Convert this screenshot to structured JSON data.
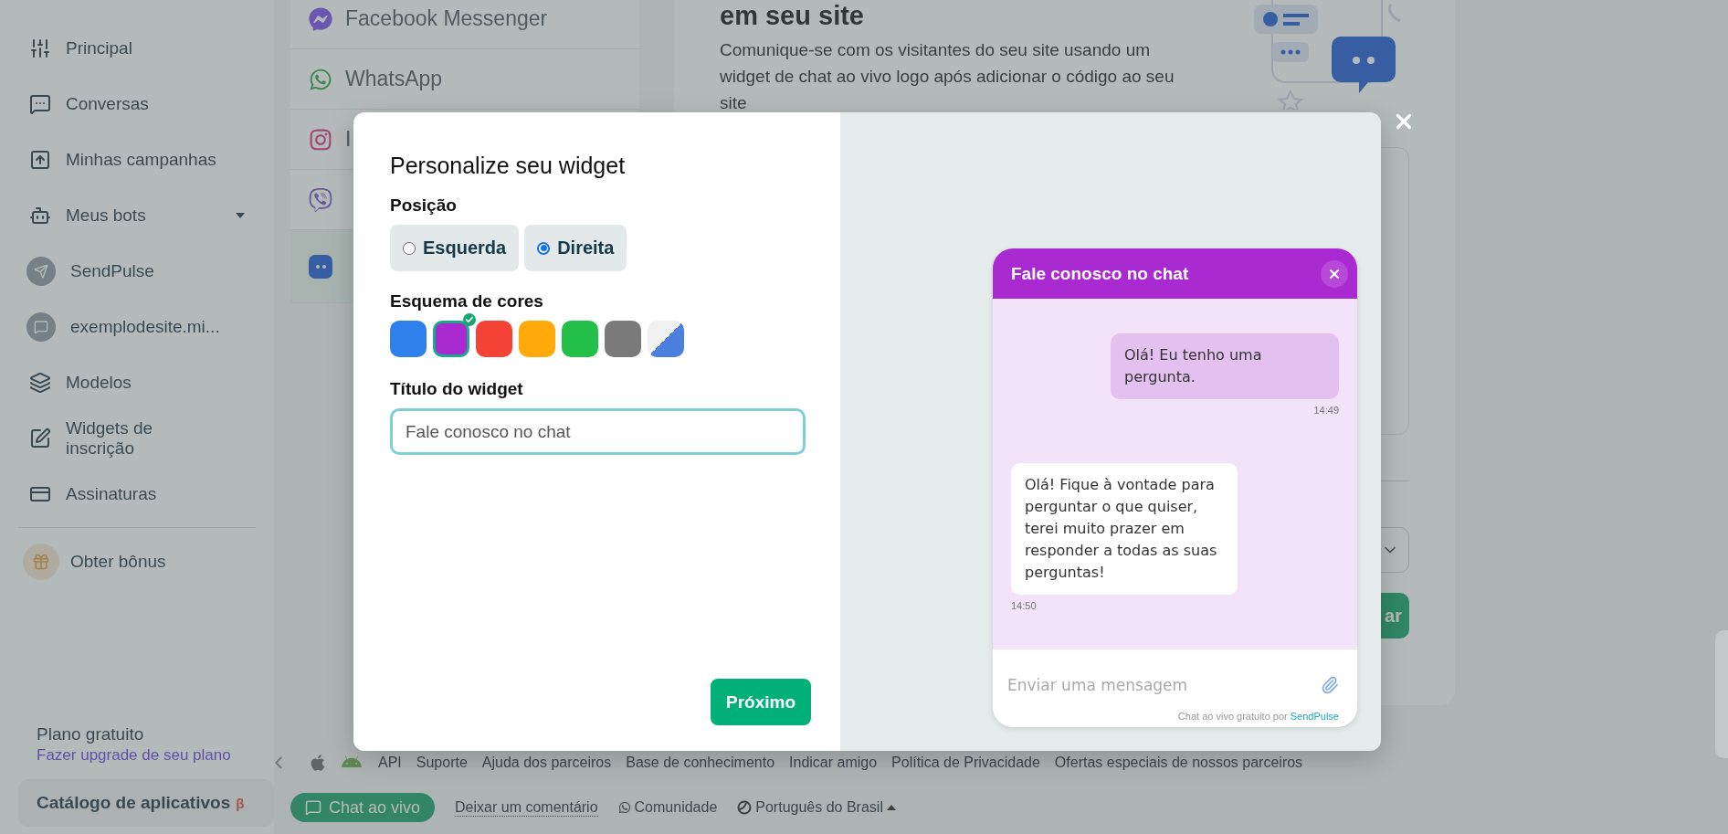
{
  "sidebar": {
    "items": [
      {
        "kind": "nav",
        "label": "Principal",
        "selected": false
      },
      {
        "kind": "nav",
        "label": "Conversas",
        "selected": false
      },
      {
        "kind": "nav",
        "label": "Minhas campanhas",
        "selected": false
      },
      {
        "kind": "group",
        "label": "Meus bots",
        "expanded": true
      },
      {
        "kind": "bot",
        "label": "SendPulse"
      },
      {
        "kind": "bot",
        "label": "exemplodesite.mi..."
      },
      {
        "kind": "nav",
        "label": "Modelos",
        "selected": false
      },
      {
        "kind": "nav",
        "label": "Widgets de inscrição",
        "selected": false
      },
      {
        "kind": "nav",
        "label": "Assinaturas",
        "selected": false
      },
      {
        "kind": "bonus",
        "label": "Obter bônus"
      }
    ],
    "plan": {
      "name": "Plano gratuito",
      "upgrade_link": "Fazer upgrade de seu plano"
    },
    "catalog_button": {
      "label": "Catálogo de aplicativos",
      "badge": "β"
    }
  },
  "channels": [
    {
      "label": "Facebook Messenger",
      "selected": false
    },
    {
      "label": "WhatsApp",
      "selected": false
    },
    {
      "label": "I",
      "selected": false
    },
    {
      "selected": false
    },
    {
      "selected": true
    }
  ],
  "main_card": {
    "heading": "em seu site",
    "description": "Comunique-se com os visitantes do seu site usando um widget de chat ao vivo logo após adicionar o código ao seu site",
    "button_fragment": "ar"
  },
  "footer": {
    "links": [
      "API",
      "Suporte",
      "Ajuda dos parceiros",
      "Base de conhecimento",
      "Indicar amigo",
      "Política de Privacidade",
      "Ofertas especiais de nossos parceiros"
    ],
    "live_chat_button": "Chat ao vivo",
    "feedback_link": "Deixar um comentário",
    "community_link": "Comunidade",
    "language": "Português do Brasil"
  },
  "modal": {
    "title": "Personalize seu widget",
    "position_label": "Posição",
    "positions": [
      {
        "label": "Esquerda",
        "selected": false
      },
      {
        "label": "Direita",
        "selected": true
      }
    ],
    "color_label": "Esquema de cores",
    "swatches": [
      {
        "kind": "solid",
        "color": "#2f80ed",
        "selected": false
      },
      {
        "kind": "solid",
        "color": "#aa2ad1",
        "selected": true
      },
      {
        "kind": "solid",
        "color": "#f44336",
        "selected": false
      },
      {
        "kind": "solid",
        "color": "#ffa90a",
        "selected": false
      },
      {
        "kind": "solid",
        "color": "#22c048",
        "selected": false
      },
      {
        "kind": "solid",
        "color": "#7a7a7a",
        "selected": false
      },
      {
        "kind": "split",
        "color": "#4a7fe0",
        "selected": false
      }
    ],
    "title_label": "Título do widget",
    "title_value": "Fale conosco no chat",
    "next_button": "Próximo",
    "preview": {
      "header": "Fale conosco no chat",
      "messages": [
        {
          "kind": "visitor",
          "text": "Olá! Eu tenho uma pergunta.",
          "time": "14:49"
        },
        {
          "kind": "agent",
          "text": "Olá! Fique à vontade para perguntar o que quiser, terei muito prazer em responder a todas as suas perguntas!",
          "time": "14:50"
        }
      ],
      "input_placeholder": "Enviar uma mensagem",
      "credit": "Chat ao vivo gratuito por",
      "credit_link": "SendPulse"
    }
  }
}
